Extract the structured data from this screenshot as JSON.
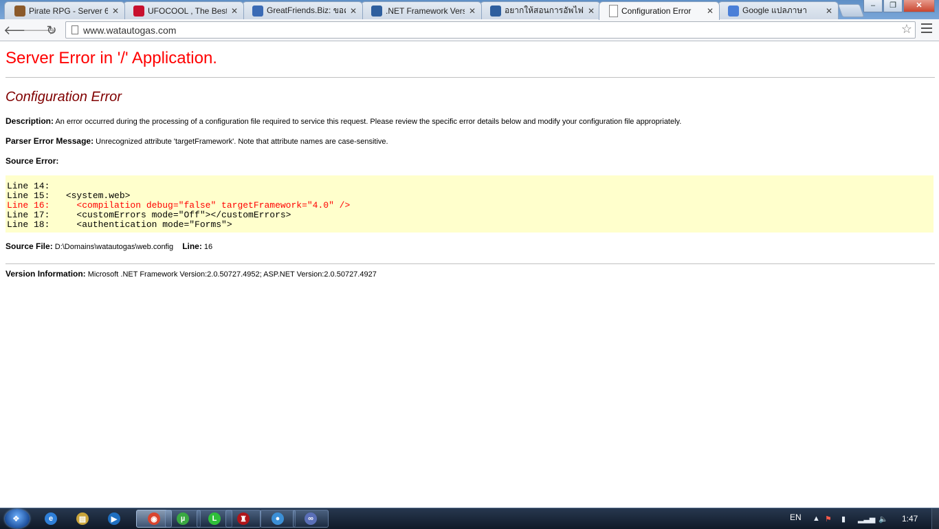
{
  "browser": {
    "tabs": [
      {
        "title": "Pirate RPG - Server 6",
        "favicon": "pirate-icon",
        "color": "#8b5a2b",
        "active": false
      },
      {
        "title": "UFOCOOL , The Best C",
        "favicon": "ufocool-icon",
        "color": "#c8102e",
        "active": false
      },
      {
        "title": "GreatFriends.Biz: ขอคำแ",
        "favicon": "greatfriends-icon",
        "color": "#3b6bb5",
        "active": false
      },
      {
        "title": ".NET Framework Versio",
        "favicon": "forum-icon",
        "color": "#2f5f9e",
        "active": false
      },
      {
        "title": "อยากให้สอนการอัพไฟล์ .",
        "favicon": "forum-icon",
        "color": "#2f5f9e",
        "active": false
      },
      {
        "title": "Configuration Error",
        "favicon": "page-icon",
        "color": "#9aa3ad",
        "active": true
      },
      {
        "title": "Google แปลภาษา",
        "favicon": "google-translate-icon",
        "color": "#4a7fd8",
        "active": false
      }
    ],
    "url": "www.watautogas.com"
  },
  "page": {
    "title": "Server Error in '/' Application.",
    "subtitle": "Configuration Error",
    "description_label": "Description:",
    "description_text": "An error occurred during the processing of a configuration file required to service this request. Please review the specific error details below and modify your configuration file appropriately.",
    "parser_label": "Parser Error Message:",
    "parser_text": "Unrecognized attribute 'targetFramework'. Note that attribute names are case-sensitive.",
    "source_error_label": "Source Error:",
    "code_lines": [
      {
        "text": "Line 14:",
        "error": false
      },
      {
        "text": "Line 15:   <system.web>",
        "error": false
      },
      {
        "text": "Line 16:     <compilation debug=\"false\" targetFramework=\"4.0\" />",
        "error": true
      },
      {
        "text": "Line 17:     <customErrors mode=\"Off\"></customErrors>",
        "error": false
      },
      {
        "text": "Line 18:     <authentication mode=\"Forms\">",
        "error": false
      }
    ],
    "source_file_label": "Source File:",
    "source_file_value": "D:\\Domains\\watautogas\\web.config",
    "line_label": "Line:",
    "line_value": "16",
    "version_label": "Version Information:",
    "version_text": "Microsoft .NET Framework Version:2.0.50727.4952; ASP.NET Version:2.0.50727.4927"
  },
  "taskbar": {
    "items": [
      {
        "name": "internet-explorer-icon",
        "glyph": "e",
        "color": "#2f7fd8",
        "active": false
      },
      {
        "name": "file-explorer-icon",
        "glyph": "▤",
        "color": "#c9a43a",
        "active": false
      },
      {
        "name": "media-player-icon",
        "glyph": "▶",
        "color": "#1f6fc0",
        "active": false
      },
      {
        "name": "chrome-icon",
        "glyph": "◉",
        "color": "#d9442e",
        "active": true
      },
      {
        "name": "utorrent-icon",
        "glyph": "µ",
        "color": "#3aa842",
        "active": false
      },
      {
        "name": "line-icon",
        "glyph": "L",
        "color": "#2fbf3a",
        "active": false
      },
      {
        "name": "game-icon",
        "glyph": "♜",
        "color": "#b0151a",
        "active": false
      },
      {
        "name": "chat-icon",
        "glyph": "●",
        "color": "#3b8fd6",
        "active": false
      },
      {
        "name": "link-icon",
        "glyph": "∞",
        "color": "#5a6fb8",
        "active": false
      }
    ],
    "language": "EN",
    "clock": "1:47"
  }
}
